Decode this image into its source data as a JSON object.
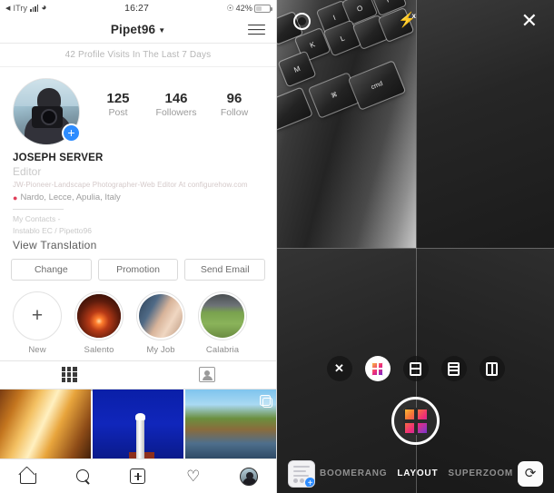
{
  "left": {
    "statusbar": {
      "carrier": "ITry",
      "time": "16:27",
      "battery_pct": "42%",
      "icons": [
        "back-caret-icon",
        "signal-bars-icon",
        "wifi-icon",
        "alarm-icon",
        "battery-icon"
      ]
    },
    "nav": {
      "username": "Pipet96",
      "chevron": "⌄",
      "menu_icon": "hamburger-menu-icon"
    },
    "visits_banner": "42 Profile Visits In The Last 7 Days",
    "profile": {
      "avatar_name": "profile-avatar",
      "add_badge": "+",
      "stats": [
        {
          "num": "125",
          "label": "Post"
        },
        {
          "num": "146",
          "label": "Followers"
        },
        {
          "num": "96",
          "label": "Follow"
        }
      ],
      "display_name": "JOSEPH SERVER",
      "category": "Editor",
      "description": "JW-Pioneer-Landscape Photographer-Web Editor At configurehow.com",
      "location": "Nardo, Lecce, Apulia, Italy",
      "contacts_line1": "My Contacts -",
      "contacts_line2": "Instablo EC / Pipetto96",
      "view_translation": "View Translation"
    },
    "buttons": [
      {
        "label": "Change"
      },
      {
        "label": "Promotion"
      },
      {
        "label": "Send Email"
      }
    ],
    "highlights": [
      {
        "label": "New",
        "type": "new"
      },
      {
        "label": "Salento",
        "type": "sunset"
      },
      {
        "label": "My Job",
        "type": "job"
      },
      {
        "label": "Calabria",
        "type": "calabria"
      }
    ],
    "tabs": [
      {
        "name": "grid-tab",
        "icon": "grid-icon",
        "selected": true
      },
      {
        "name": "tagged-tab",
        "icon": "tagged-person-icon",
        "selected": false
      }
    ],
    "photos": [
      {
        "name": "photo-autumn-forest",
        "multi": false
      },
      {
        "name": "photo-lighthouse-night",
        "multi": false
      },
      {
        "name": "photo-coastal-landscape",
        "multi": true
      }
    ],
    "bottom_nav": [
      {
        "name": "home-icon"
      },
      {
        "name": "search-icon"
      },
      {
        "name": "add-post-icon"
      },
      {
        "name": "activity-heart-icon"
      },
      {
        "name": "profile-avatar-icon"
      }
    ]
  },
  "right": {
    "top": {
      "settings_icon": "gear-icon",
      "flash_icon": "flash-off-icon",
      "flash_bolt": "⚡",
      "flash_x": "x",
      "close_label": "✕"
    },
    "preview": {
      "description": "macbook-keyboard-camera-preview",
      "keys": [
        "I",
        "O",
        "P",
        "K",
        "L",
        "M",
        "⌘",
        "cmd"
      ]
    },
    "layout_options": [
      {
        "name": "layout-close-button",
        "kind": "close",
        "label": "✕",
        "selected": false
      },
      {
        "name": "layout-grid-2x2",
        "kind": "grid-2x2",
        "selected": true
      },
      {
        "name": "layout-grid-1x2",
        "kind": "grid-1x2",
        "selected": false
      },
      {
        "name": "layout-grid-1x3",
        "kind": "grid-1x3",
        "selected": false
      },
      {
        "name": "layout-grid-2x1",
        "kind": "grid-2x1",
        "selected": false
      }
    ],
    "shutter": {
      "name": "layout-shutter-button"
    },
    "mode_bar": {
      "gallery_thumb": "gallery-thumbnail",
      "gallery_plus": "+",
      "modes": [
        {
          "label": "BOOMERANG",
          "active": false
        },
        {
          "label": "LAYOUT",
          "active": true
        },
        {
          "label": "SUPERZOOM",
          "active": false
        }
      ],
      "flip_icon": "camera-flip-icon",
      "flip_glyph": "⟳"
    }
  },
  "colors": {
    "accent_blue": "#2d8cff",
    "pin_red": "#e0415b",
    "gradient_start": "#f9ce34",
    "gradient_mid": "#ee2a7b",
    "gradient_end": "#6228d7"
  }
}
